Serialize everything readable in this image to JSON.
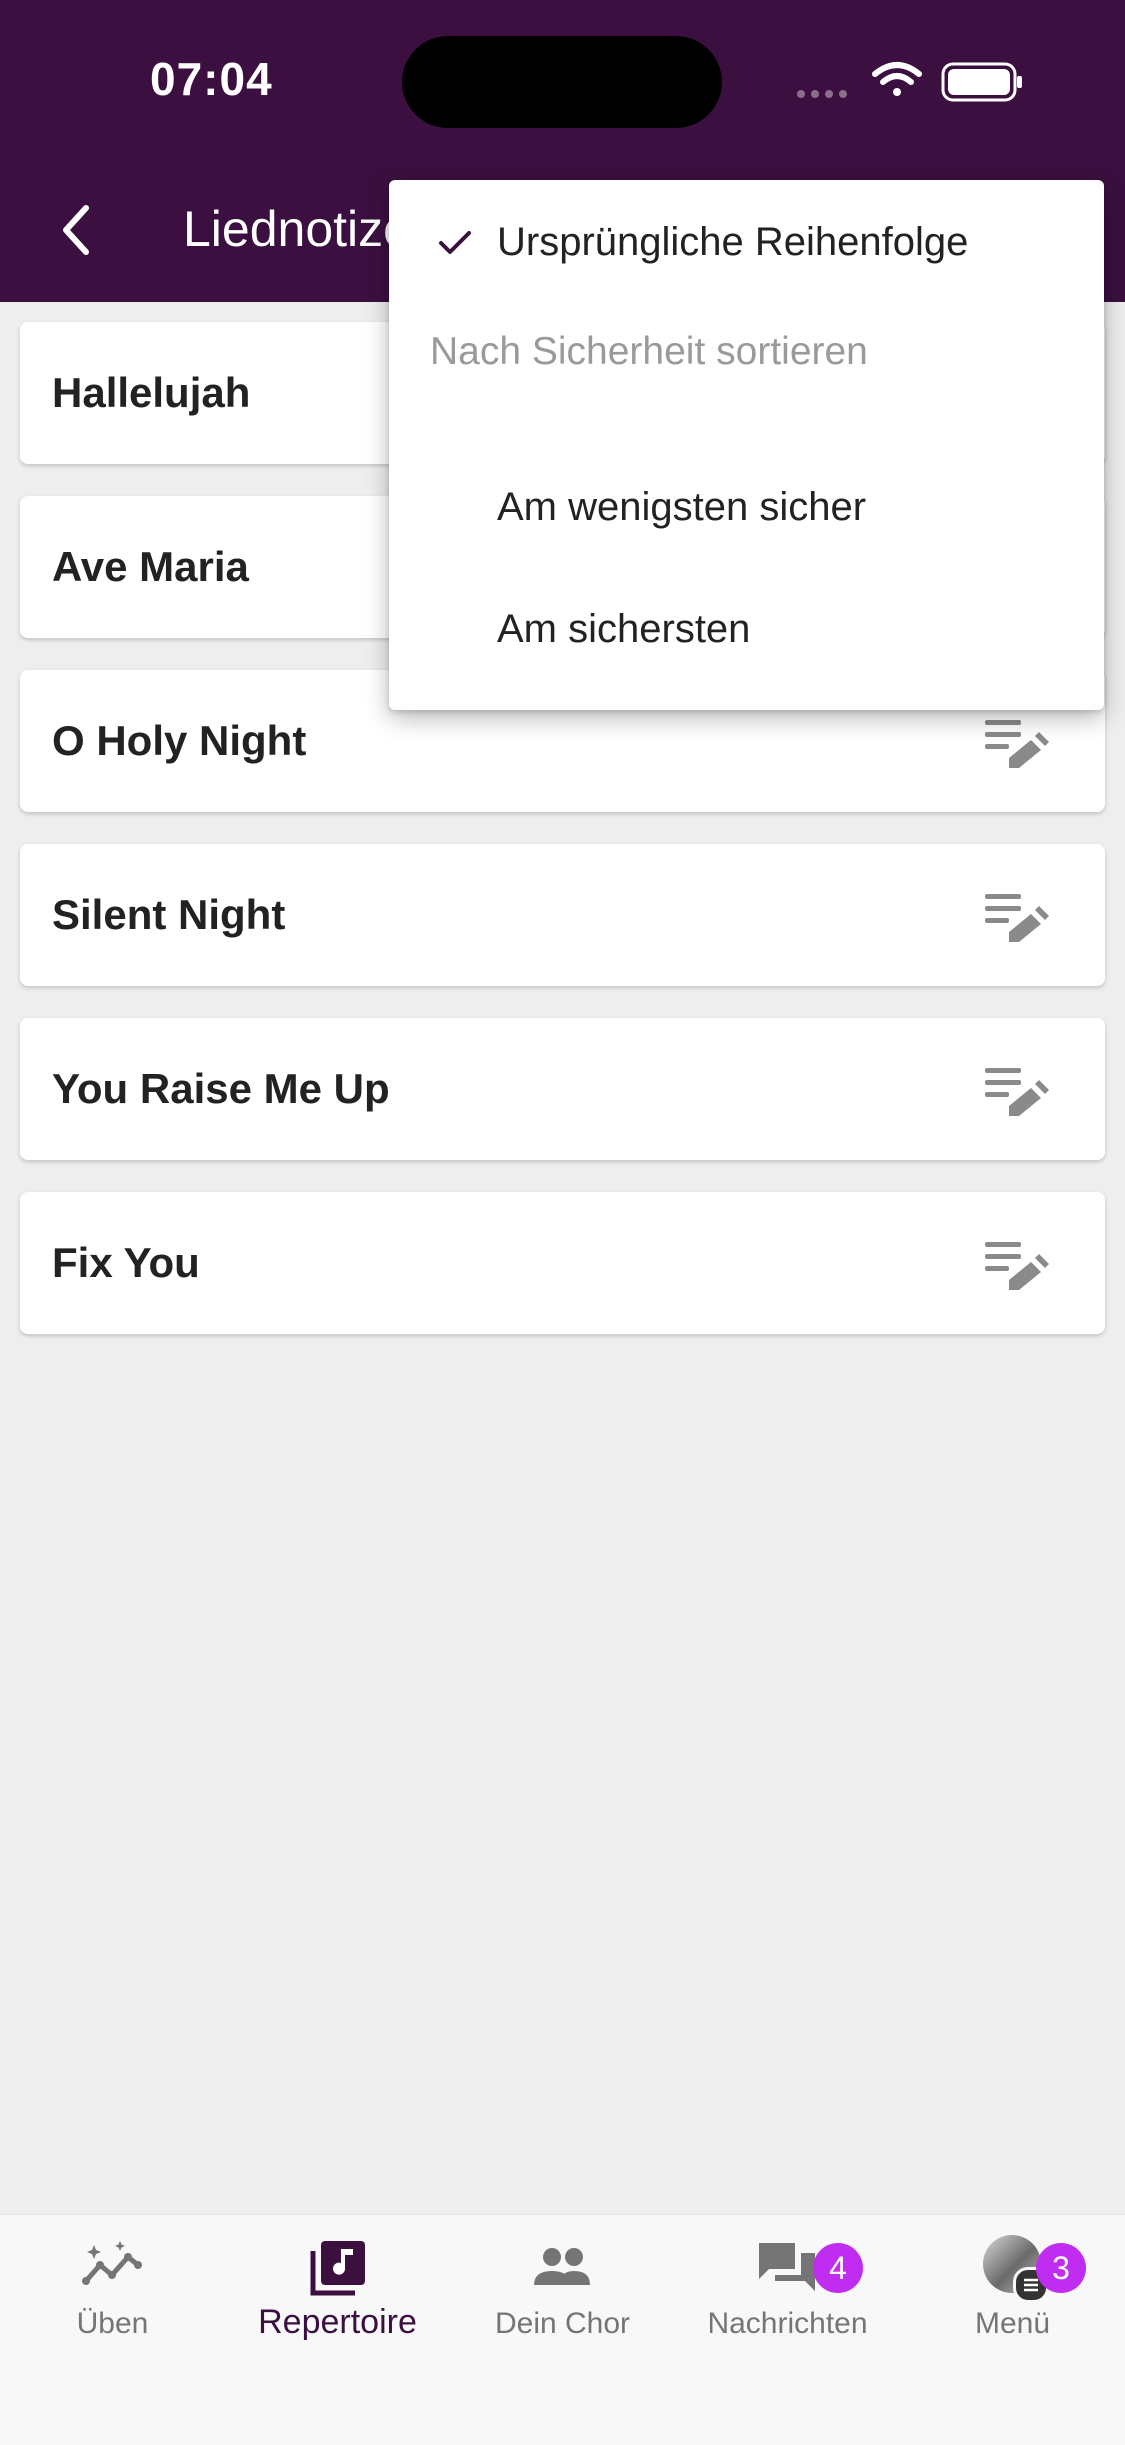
{
  "colors": {
    "brand": "#3b1040",
    "accent": "#c02cf0"
  },
  "status_bar": {
    "time": "07:04"
  },
  "header": {
    "title": "Liednotizen",
    "back_icon": "chevron-left-icon"
  },
  "songs": [
    {
      "title": "Hallelujah"
    },
    {
      "title": "Ave Maria"
    },
    {
      "title": "O Holy Night"
    },
    {
      "title": "Silent Night"
    },
    {
      "title": "You Raise Me Up"
    },
    {
      "title": "Fix You"
    }
  ],
  "sort_menu": {
    "selected": "Ursprüngliche Reihenfolge",
    "section_header": "Nach Sicherheit sortieren",
    "options": [
      "Ursprüngliche Reihenfolge",
      "Am wenigsten sicher",
      "Am sichersten"
    ]
  },
  "bottom_nav": {
    "items": [
      {
        "label": "Üben",
        "icon": "practice-chart-icon"
      },
      {
        "label": "Repertoire",
        "icon": "music-library-icon",
        "active": true
      },
      {
        "label": "Dein Chor",
        "icon": "group-icon"
      },
      {
        "label": "Nachrichten",
        "icon": "chat-icon",
        "badge": "4"
      },
      {
        "label": "Menü",
        "icon": "avatar",
        "badge": "3"
      }
    ]
  }
}
